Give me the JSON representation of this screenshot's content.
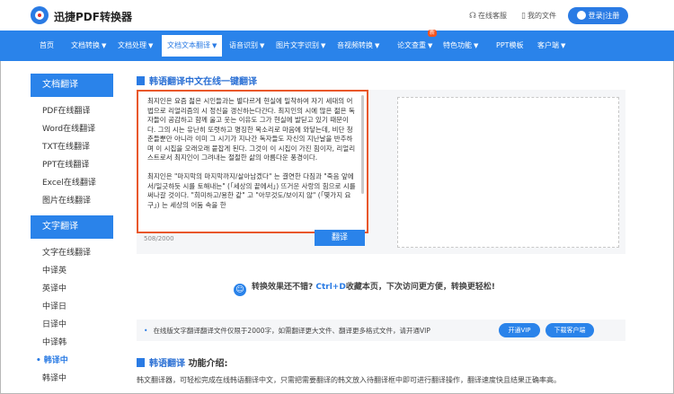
{
  "header": {
    "brand": "迅捷PDF转换器",
    "online_service": "在线客服",
    "my_files": "我的文件",
    "login": "登录|注册"
  },
  "nav": {
    "items": [
      {
        "label": "首页",
        "arrow": false
      },
      {
        "label": "文档转换",
        "arrow": true
      },
      {
        "label": "文档处理",
        "arrow": true
      },
      {
        "label": "文档文本翻译",
        "arrow": true
      },
      {
        "label": "语音识别",
        "arrow": true
      },
      {
        "label": "图片文字识别",
        "arrow": true
      },
      {
        "label": "音视频转换",
        "arrow": true
      },
      {
        "label": "论文查重",
        "arrow": true,
        "badge": "新"
      },
      {
        "label": "特色功能",
        "arrow": true
      },
      {
        "label": "PPT模板",
        "arrow": false
      },
      {
        "label": "客户端",
        "arrow": true
      }
    ],
    "arrow_glyph": "▼"
  },
  "sidebar": {
    "section1": "文档翻译",
    "items1": [
      "PDF在线翻译",
      "Word在线翻译",
      "TXT在线翻译",
      "PPT在线翻译",
      "Excel在线翻译",
      "图片在线翻译"
    ],
    "section2": "文字翻译",
    "items2": [
      "文字在线翻译",
      "中译英",
      "英译中",
      "中译日",
      "日译中",
      "中译韩",
      "韩译中",
      "韩译中"
    ]
  },
  "main": {
    "title": "韩语翻译中文在线一键翻译",
    "source_text": "최지인은 요즘 젊은 시인들과는 별다르게 현실에 밀착하여 자기 세대의 어법으로 리얼리즘의 시 정신을 갱신하는다간다. 최지인의 시에 많은 젊은 독자들이 공감하고 함께 울고 웃는 이유도 그가 현실에 발딛고 있기 때문이다. 그의 시는 유난히 또렷하고 명징한 목소리로 마음에 와닿는데, 비단 청춘들뿐만 아니라 이미 그 시기가 지나간 독자들도 자신의 지난날을 반추하며 이 시집을 오래오래 붙잡게 된다. 그것이 이 시집이 가진 힘이자, 리얼리스트로서 최지인이 그려내는 절절한 삶의 아름다운 풍경이다.\n\n최지인은 \"마지막의 마지막까지/살아남겠다\" 는 결연한 다짐과 \"죽음 앞에서/일긋하듯 시를 토해내는\" (「세상의 끝에서」) 뜨거운 사랑의 힘으로 시를 써나갈 것이다. \"희미하고/용한 같\" 고 \"아무것도/보이지 않\" (「몇가지 요구」) 는 세상의 어둠 속을 한",
    "counter": "508/2000",
    "translate": "翻译"
  },
  "promo": {
    "text_before": "转换效果还不错? ",
    "shortcut": "Ctrl+D",
    "text_after": "收藏本页，下次访问更方便，转换更轻松!"
  },
  "notice": {
    "text": "在线版文字翻译翻译文件仅限于2000字，如需翻译更大文件、翻译更多格式文件，请开通VIP",
    "vip_button": "开通VIP",
    "client_button": "下载客户端"
  },
  "intro": {
    "title_blue": "韩语翻译",
    "title_black": " 功能介绍:",
    "text": "韩文翻译器，可轻松完成在线韩语翻译中文，只需把需要翻译的韩文放入待翻译框中即可进行翻译操作，翻译速度快且结果正确率高。"
  }
}
